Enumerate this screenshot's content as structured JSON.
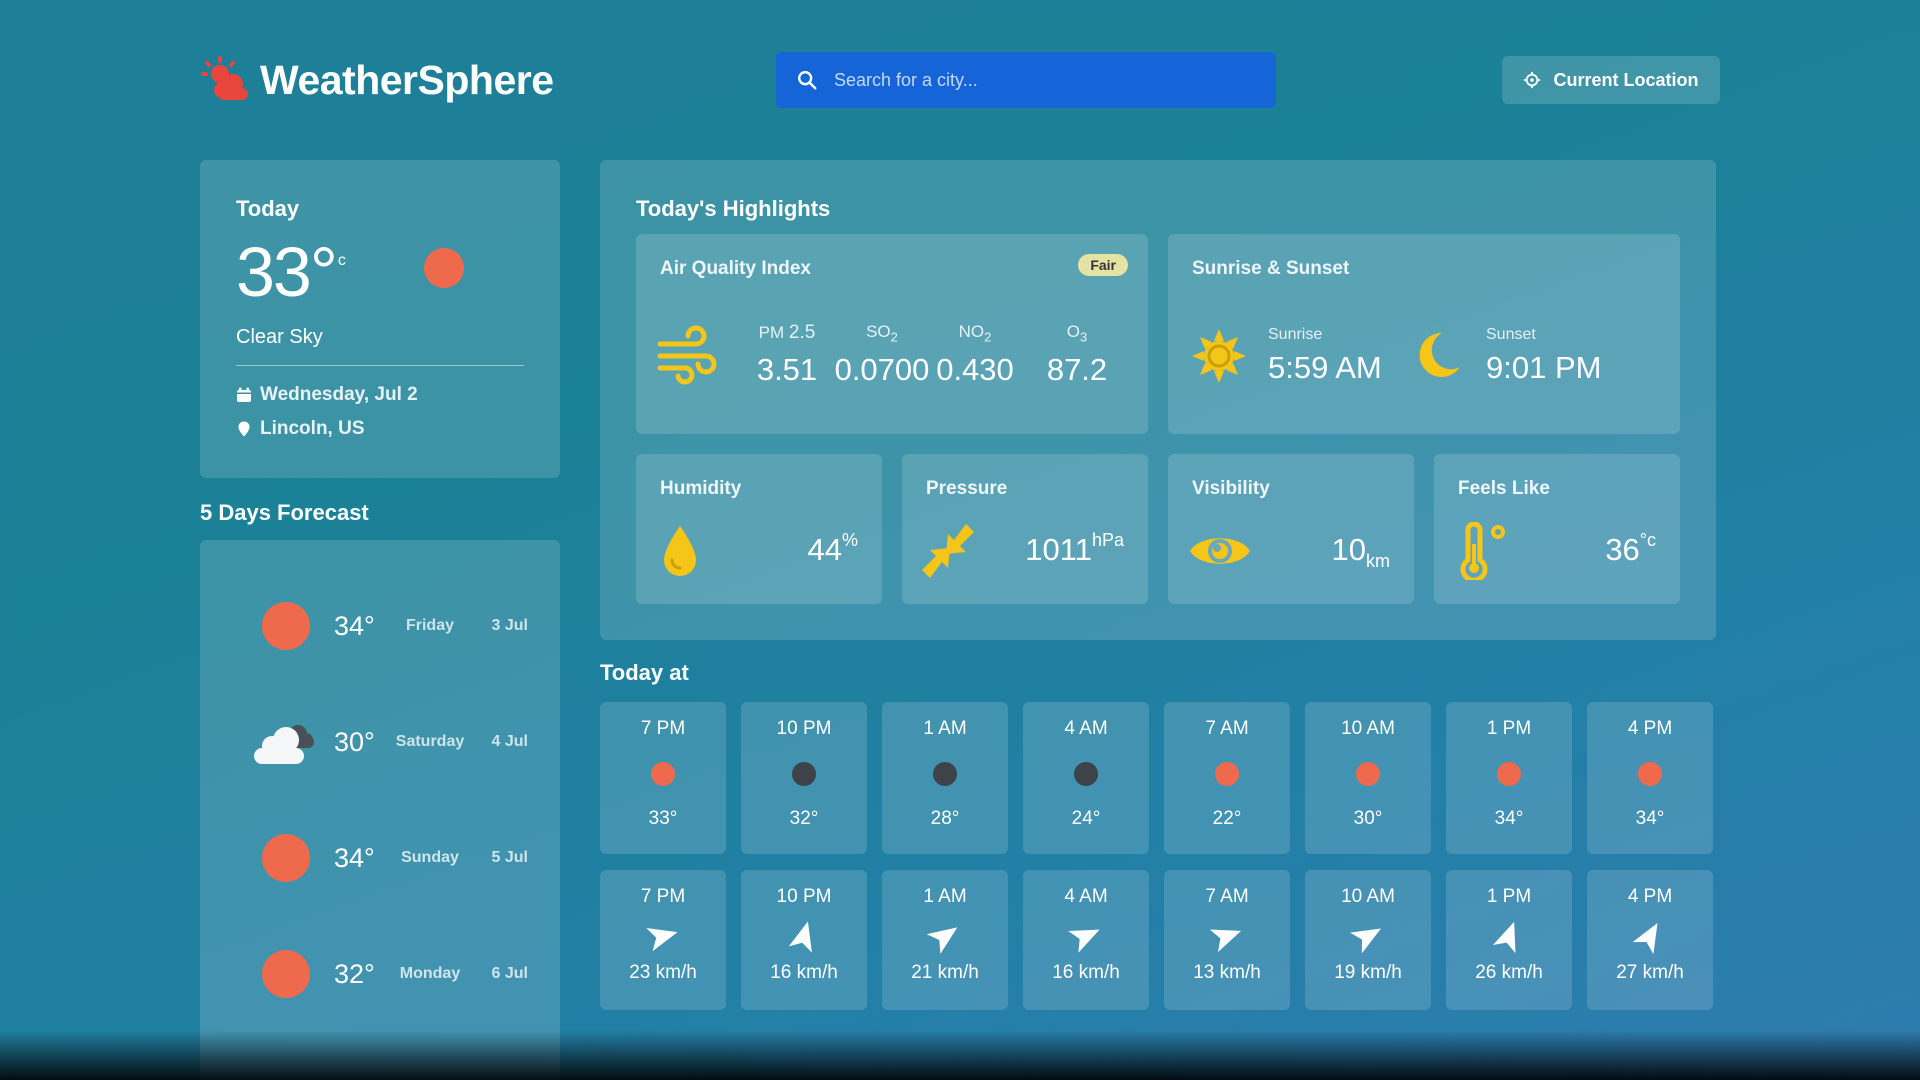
{
  "app": {
    "name": "WeatherSphere"
  },
  "search": {
    "placeholder": "Search for a city..."
  },
  "location_button": {
    "label": "Current Location"
  },
  "today": {
    "label": "Today",
    "temp": "33°",
    "unit": "c",
    "condition": "Clear Sky",
    "date": "Wednesday, Jul 2",
    "location": "Lincoln, US"
  },
  "forecast": {
    "title": "5 Days Forecast",
    "days": [
      {
        "temp": "34°",
        "day": "Friday",
        "date": "3 Jul",
        "icon": "sun-icon"
      },
      {
        "temp": "30°",
        "day": "Saturday",
        "date": "4 Jul",
        "icon": "cloud-icon"
      },
      {
        "temp": "34°",
        "day": "Sunday",
        "date": "5 Jul",
        "icon": "sun-icon"
      },
      {
        "temp": "32°",
        "day": "Monday",
        "date": "6 Jul",
        "icon": "sun-icon"
      }
    ]
  },
  "highlights": {
    "title": "Today's Highlights",
    "aqi": {
      "title": "Air Quality Index",
      "badge": "Fair",
      "items": [
        {
          "label_main": "PM",
          "label_sub": "2.5",
          "value": "3.51"
        },
        {
          "label_main": "SO",
          "label_sub": "2",
          "value": "0.0700"
        },
        {
          "label_main": "NO",
          "label_sub": "2",
          "value": "0.430"
        },
        {
          "label_main": "O",
          "label_sub": "3",
          "value": "87.2"
        }
      ]
    },
    "sun": {
      "title": "Sunrise & Sunset",
      "sunrise_label": "Sunrise",
      "sunrise": "5:59 AM",
      "sunset_label": "Sunset",
      "sunset": "9:01 PM"
    },
    "humidity": {
      "title": "Humidity",
      "value": "44",
      "unit": "%"
    },
    "pressure": {
      "title": "Pressure",
      "value": "1011",
      "unit": "hPa"
    },
    "visibility": {
      "title": "Visibility",
      "value": "10",
      "unit": "km"
    },
    "feels_like": {
      "title": "Feels Like",
      "value": "36",
      "unit": "°c"
    }
  },
  "today_at": {
    "title": "Today at",
    "hourly": [
      {
        "time": "7 PM",
        "temp": "33°",
        "icon": "sun-icon",
        "color": "#ef6a4d"
      },
      {
        "time": "10 PM",
        "temp": "32°",
        "icon": "moon-icon",
        "color": "#3d4348"
      },
      {
        "time": "1 AM",
        "temp": "28°",
        "icon": "moon-icon",
        "color": "#3d4348"
      },
      {
        "time": "4 AM",
        "temp": "24°",
        "icon": "moon-icon",
        "color": "#3d4348"
      },
      {
        "time": "7 AM",
        "temp": "22°",
        "icon": "sun-icon",
        "color": "#ef6a4d"
      },
      {
        "time": "10 AM",
        "temp": "30°",
        "icon": "sun-icon",
        "color": "#ef6a4d"
      },
      {
        "time": "1 PM",
        "temp": "34°",
        "icon": "sun-icon",
        "color": "#ef6a4d"
      },
      {
        "time": "4 PM",
        "temp": "34°",
        "icon": "sun-icon",
        "color": "#ef6a4d"
      }
    ],
    "wind": [
      {
        "time": "7 PM",
        "speed": "23 km/h",
        "direction_deg": 75
      },
      {
        "time": "10 PM",
        "speed": "16 km/h",
        "direction_deg": 15
      },
      {
        "time": "1 AM",
        "speed": "21 km/h",
        "direction_deg": 55
      },
      {
        "time": "4 AM",
        "speed": "16 km/h",
        "direction_deg": 65
      },
      {
        "time": "7 AM",
        "speed": "13 km/h",
        "direction_deg": 70
      },
      {
        "time": "10 AM",
        "speed": "19 km/h",
        "direction_deg": 60
      },
      {
        "time": "1 PM",
        "speed": "26 km/h",
        "direction_deg": 20
      },
      {
        "time": "4 PM",
        "speed": "27 km/h",
        "direction_deg": 30
      }
    ]
  },
  "colors": {
    "accent": "#1565d8",
    "sun": "#ef6a4d",
    "moon": "#3d4348",
    "highlight_icon": "#f5c518",
    "logo": "#e8453c"
  }
}
